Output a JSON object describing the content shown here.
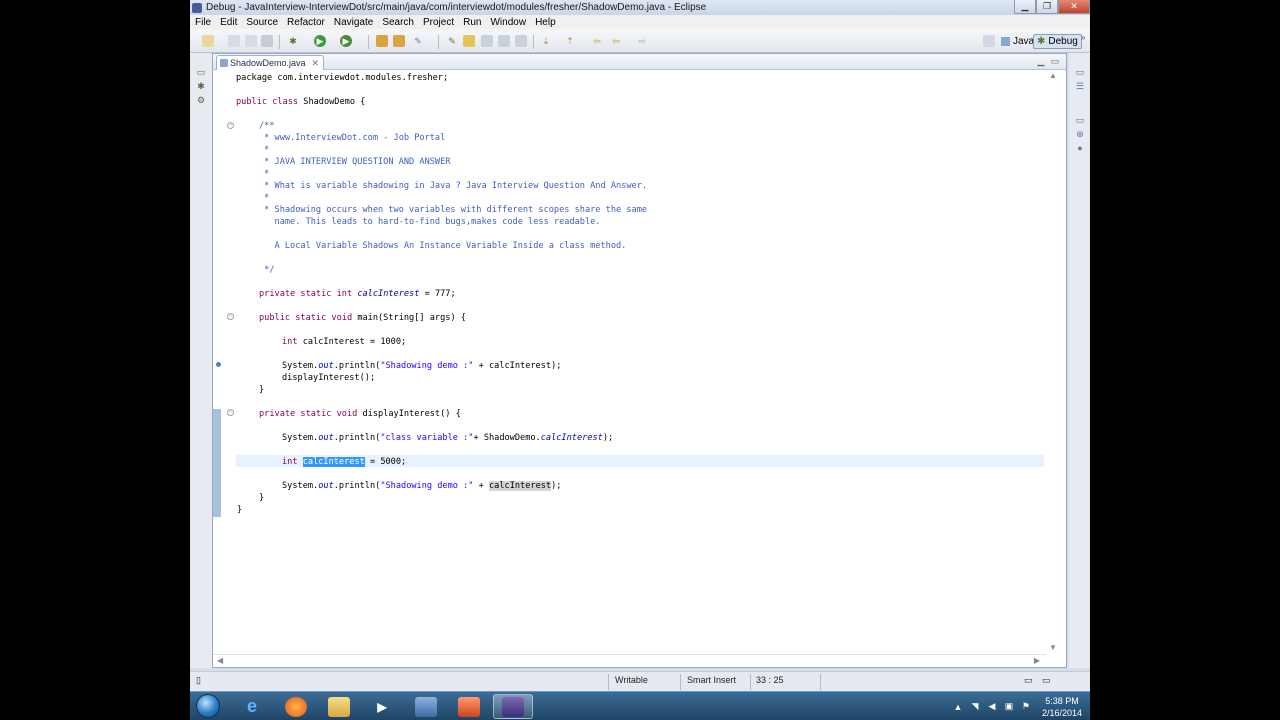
{
  "window": {
    "title": "Debug - JavaInterview-InterviewDot/src/main/java/com/interviewdot/modules/fresher/ShadowDemo.java - Eclipse"
  },
  "menu": [
    "File",
    "Edit",
    "Source",
    "Refactor",
    "Navigate",
    "Search",
    "Project",
    "Run",
    "Window",
    "Help"
  ],
  "perspectives": {
    "java": "Java",
    "debug": "Debug"
  },
  "editor": {
    "tab_label": "ShadowDemo.java",
    "code": {
      "l1": "package com.interviewdot.modules.fresher;",
      "l2_kw": "public class",
      "l2_rest": " ShadowDemo {",
      "c0": "/**",
      "c1": " * www.InterviewDot.com - Job Portal",
      "c2": " *",
      "c3": " * JAVA INTERVIEW QUESTION AND ANSWER",
      "c4": " *",
      "c5": " * What is variable shadowing in Java ? Java Interview Question And Answer.",
      "c6": " *",
      "c7": " * Shadowing occurs when two variables with different scopes share the same",
      "c8": "   name. This leads to hard-to-find bugs,makes code less readable.",
      "c9": "   A Local Variable Shadows An Instance Variable Inside a class method.",
      "c10": " */",
      "f_kw": "private static int",
      "f_name": "calcInterest",
      "f_rest": " = 777;",
      "m_kw": "public static void",
      "m_rest": " main(String[] args) {",
      "m1_kw": "int",
      "m1_rest": " calcInterest = 1000;",
      "m2_a": "System.",
      "m2_out": "out",
      "m2_b": ".println(",
      "m2_str": "\"Shadowing demo :\"",
      "m2_c": " + calcInterest);",
      "m3": "displayInterest();",
      "brace_close": "}",
      "d_kw": "private static void",
      "d_rest": " displayInterest() {",
      "d1_a": "System.",
      "d1_out": "out",
      "d1_b": ".println(",
      "d1_str": "\"class variable :\"",
      "d1_c": "+ ShadowDemo.",
      "d1_fld": "calcInterest",
      "d1_d": ");",
      "d2_kw": "int",
      "d2_sel": "calcInterest",
      "d2_rest": " = 5000;",
      "d3_a": "System.",
      "d3_out": "out",
      "d3_b": ".println(",
      "d3_str": "\"Shadowing demo :\"",
      "d3_c": " + ",
      "d3_occ": "calcInterest",
      "d3_d": ");",
      "class_close": "}"
    }
  },
  "status": {
    "mode": "Writable",
    "insert": "Smart Insert",
    "position": "33 : 25"
  },
  "clock": {
    "time": "5:38 PM",
    "date": "2/16/2014"
  }
}
